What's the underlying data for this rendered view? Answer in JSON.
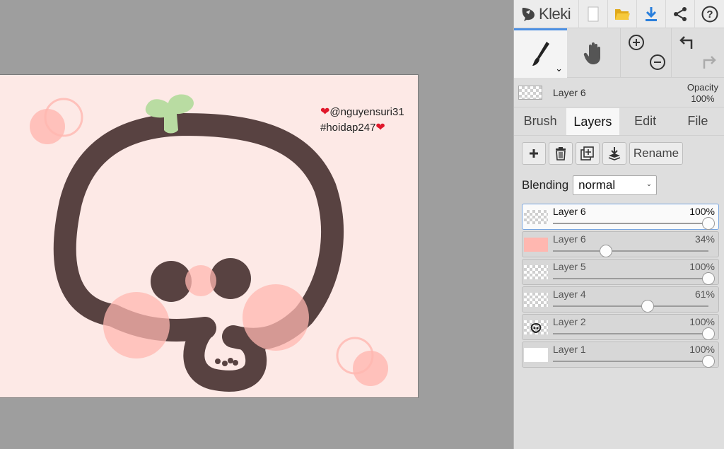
{
  "app": {
    "name": "Kleki"
  },
  "toolbar": {
    "new_icon": "new-page-icon",
    "open_icon": "folder-icon",
    "download_icon": "download-icon",
    "share_icon": "share-icon",
    "help_icon": "help-icon"
  },
  "tools": {
    "brush": "brush-icon",
    "hand": "hand-icon",
    "zoom_in": "zoom-in-icon",
    "zoom_out": "zoom-out-icon",
    "undo": "undo-icon",
    "redo": "redo-icon"
  },
  "current_layer": {
    "name": "Layer 6",
    "opacity_label": "Opacity",
    "opacity_value": "100%"
  },
  "tabs": [
    {
      "label": "Brush",
      "active": false
    },
    {
      "label": "Layers",
      "active": true
    },
    {
      "label": "Edit",
      "active": false
    },
    {
      "label": "File",
      "active": false
    }
  ],
  "layer_buttons": {
    "add_icon": "plus-icon",
    "delete_icon": "trash-icon",
    "duplicate_icon": "duplicate-icon",
    "merge_icon": "merge-down-icon",
    "rename_label": "Rename"
  },
  "blending": {
    "label": "Blending",
    "value": "normal"
  },
  "layers": [
    {
      "name": "Layer 6",
      "opacity_label": "100%",
      "opacity": 1.0,
      "selected": true,
      "thumb": "checker"
    },
    {
      "name": "Layer 6",
      "opacity_label": "34%",
      "opacity": 0.34,
      "selected": false,
      "thumb": "pink"
    },
    {
      "name": "Layer 5",
      "opacity_label": "100%",
      "opacity": 1.0,
      "selected": false,
      "thumb": "checker"
    },
    {
      "name": "Layer 4",
      "opacity_label": "61%",
      "opacity": 0.61,
      "selected": false,
      "thumb": "checker"
    },
    {
      "name": "Layer 2",
      "opacity_label": "100%",
      "opacity": 1.0,
      "selected": false,
      "thumb": "drawing"
    },
    {
      "name": "Layer 1",
      "opacity_label": "100%",
      "opacity": 1.0,
      "selected": false,
      "thumb": "white"
    }
  ],
  "canvas": {
    "watermark_line1": "@nguyensuri31",
    "watermark_line2": "#hoidap247",
    "heart_glyph": "❤"
  },
  "colors": {
    "canvas_bg": "#fde9e6",
    "stroke": "#584241",
    "blush": "#ffb7b0",
    "leaf": "#b9dca2",
    "accent": "#4b8fe2",
    "download": "#2a7fdc"
  }
}
